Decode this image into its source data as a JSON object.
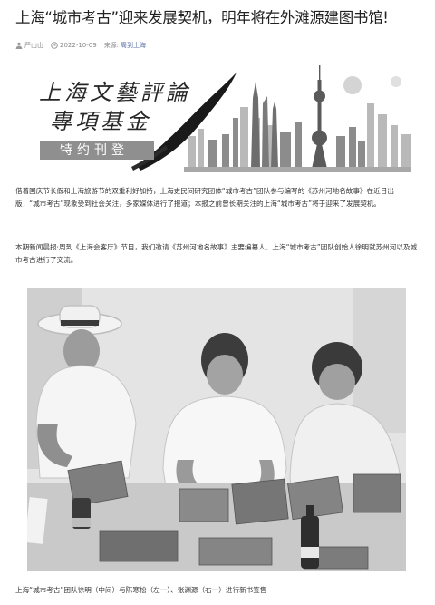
{
  "article": {
    "title": "上海“城市考古”迎来发展契机，明年将在外滩源建图书馆!",
    "author": "严山山",
    "date": "2022-10-09",
    "source_label": "来源:",
    "source_name": "周到上海"
  },
  "banner": {
    "title_line1": "上海文藝評論",
    "title_line2": "專項基金",
    "subtitle": "特约刊登"
  },
  "body": {
    "paragraph1": "借着国庆节长假和上海旅游节的双重利好加持，上海史民间研究团体“城市考古”团队参与编写的《苏州河地名故事》在近日出版，“城市考古”现象受到社会关注，多家媒体进行了报道；本报之前曾长期关注的上海“城市考古”将于迎来了发展契机。",
    "paragraph2": "本期新闻晨报·周到《上海会客厅》节目，我们邀请《苏州河地名故事》主要编纂人、上海“城市考古”团队创始人徐明就苏州河以及城市考古进行了交流。",
    "photo_caption": "上海“城市考古”团队徐明（中间）与陈寒松（左一）、张渊源（右一）进行新书签售"
  },
  "icons": {
    "author": "person-icon",
    "date": "clock-icon"
  }
}
